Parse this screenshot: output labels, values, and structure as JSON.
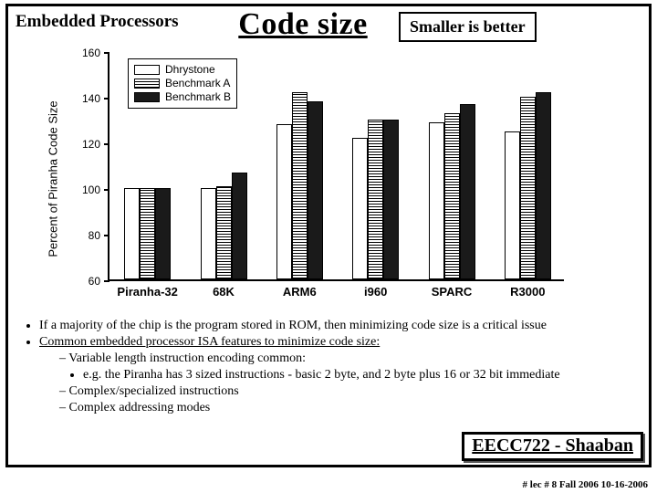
{
  "header": {
    "left": "Embedded Processors",
    "title": "Code size",
    "right": "Smaller is better"
  },
  "bullets": {
    "b1": "If a majority of the chip is the program stored in ROM, then minimizing code size is a critical issue",
    "b2": "Common embedded processor ISA features to minimize code size:",
    "b2a": "Variable length instruction encoding common:",
    "b2a1": "e.g. the Piranha has 3 sized instructions - basic 2 byte, and 2 byte plus 16 or 32 bit immediate",
    "b2b": "Complex/specialized  instructions",
    "b2c": "Complex addressing modes"
  },
  "course": "EECC722 - Shaaban",
  "footer": "#  lec # 8    Fall 2006   10-16-2006",
  "chart_data": {
    "type": "bar",
    "title": "Code size",
    "ylabel": "Percent of Piranha Code Size",
    "xlabel": "",
    "ylim": [
      60,
      160
    ],
    "yticks": [
      60,
      80,
      100,
      120,
      140,
      160
    ],
    "categories": [
      "Piranha-32",
      "68K",
      "ARM6",
      "i960",
      "SPARC",
      "R3000"
    ],
    "series": [
      {
        "name": "Dhrystone",
        "values": [
          100,
          100,
          128,
          122,
          129,
          125
        ]
      },
      {
        "name": "Benchmark A",
        "values": [
          100,
          101,
          142,
          130,
          133,
          140
        ]
      },
      {
        "name": "Benchmark B",
        "values": [
          100,
          107,
          138,
          130,
          137,
          142
        ]
      }
    ],
    "legend_position": "upper-left",
    "grid": false
  }
}
